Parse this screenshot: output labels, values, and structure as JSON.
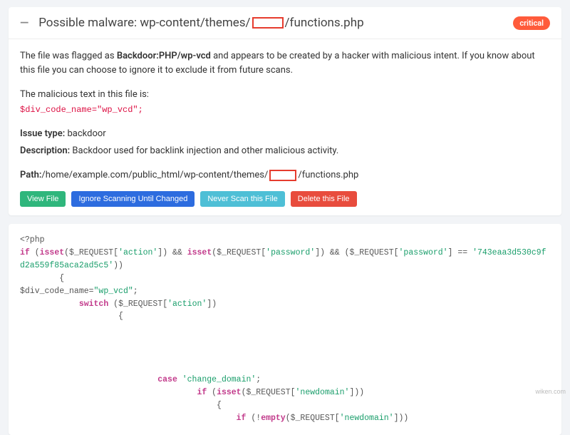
{
  "header": {
    "collapse_glyph": "—",
    "title_pre": "Possible malware: wp-content/themes/",
    "title_post": "/functions.php",
    "badge": "critical"
  },
  "description": {
    "pre": "The file was flagged as ",
    "flag": "Backdoor:PHP/wp-vcd",
    "post": " and appears to be created by a hacker with malicious intent. If you know about this file you can choose to ignore it to exclude it from future scans."
  },
  "malicious": {
    "label": "The malicious text in this file is:",
    "code": "$div_code_name=\"wp_vcd\";"
  },
  "issue": {
    "type_label": "Issue type:",
    "type_value": " backdoor",
    "desc_label": "Description:",
    "desc_value": " Backdoor used for backlink injection and other malicious activity."
  },
  "path": {
    "label": "Path:",
    "pre": " /home/example.com/public_html/wp-content/themes/",
    "post": "/functions.php"
  },
  "buttons": {
    "view": "View File",
    "ignore": "Ignore Scanning Until Changed",
    "never": "Never Scan this File",
    "delete": "Delete this File"
  },
  "code": {
    "l1a": "<?php",
    "l2_if": "if",
    "l2_isset1": "isset",
    "l2_req": "$_REQUEST",
    "l2_s_action": "'action'",
    "l2_s_password": "'password'",
    "l2_hash": "'743eaa3d530c9fd2a559f85aca2ad5c5'",
    "l3_brace": "        {",
    "l4": "$div_code_name=",
    "l4_str": "\"wp_vcd\"",
    "l5_switch": "switch",
    "l6_brace": "                    {",
    "l_case": "case",
    "l_case_str": "'change_domain'",
    "l_newdomain": "'newdomain'",
    "l_empty": "empty"
  },
  "watermark": "wiken.com"
}
